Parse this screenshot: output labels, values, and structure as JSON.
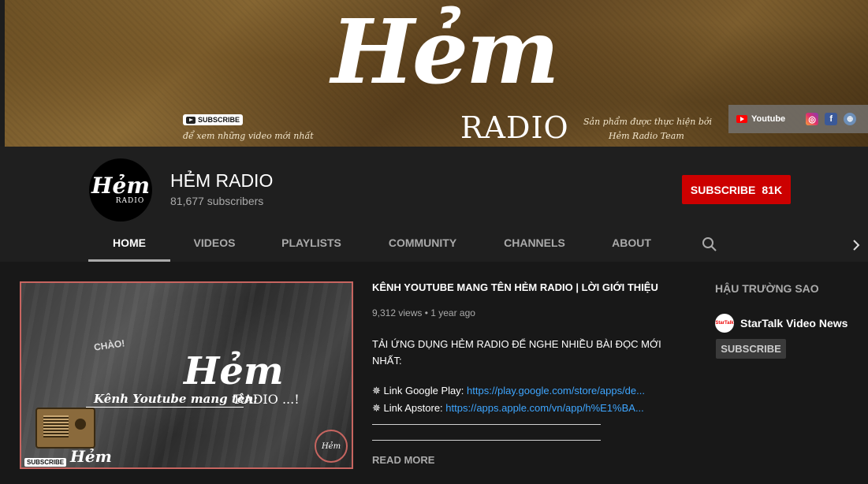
{
  "banner": {
    "logo_text": "Hẻm",
    "radio_text": "RADIO",
    "subscribe_badge": "SUBSCRIBE",
    "subscribe_caption": "để xem những video mới nhất",
    "credit_line1": "Sản phẩm được thực hiện bởi",
    "credit_line2": "Hẻm Radio Team",
    "links": {
      "youtube_label": "Youtube",
      "icons": [
        "youtube-icon",
        "instagram-icon",
        "facebook-icon",
        "website-icon"
      ]
    }
  },
  "channel": {
    "avatar_text": "Hẻm",
    "avatar_sub": "RADIO",
    "name": "HẺM RADIO",
    "subscribers": "81,677 subscribers",
    "subscribe_label": "SUBSCRIBE",
    "subscribe_count": "81K",
    "subscribe_color": "#cc0000"
  },
  "tabs": [
    "HOME",
    "VIDEOS",
    "PLAYLISTS",
    "COMMUNITY",
    "CHANNELS",
    "ABOUT"
  ],
  "active_tab": "HOME",
  "featured_video": {
    "thumbnail": {
      "chao": "CHÀO!",
      "logo": "Hẻm",
      "radio": "RADIO",
      "caption": "Kênh Youtube mang tên:",
      "ellipsis": "...!",
      "subscribe": "SUBSCRIBE",
      "bottom_logo": "Hẻm",
      "circle_logo": "Hẻm"
    },
    "title": "KÊNH YOUTUBE MANG TÊN HẺM RADIO | LỜI GIỚI THIỆU",
    "views": "9,312 views",
    "age": "1 year ago",
    "description": "TẢI ỨNG DỤNG HẺM RADIO ĐỂ NGHE NHIỀU BÀI ĐỌC MỚI NHẤT:",
    "link1_label": "✵ Link Google Play:",
    "link1_url": "https://play.google.com/store/apps/de...",
    "link2_label": "✵ Link Apstore:",
    "link2_url": "https://apps.apple.com/vn/app/h%E1%BA...",
    "read_more": "READ MORE",
    "link_color": "#3ea6ff"
  },
  "sidebar": {
    "title": "HẬU TRƯỜNG SAO",
    "channel_name": "StarTalk Video News",
    "channel_avatar_text": "StarTalk",
    "subscribe_label": "SUBSCRIBE"
  }
}
